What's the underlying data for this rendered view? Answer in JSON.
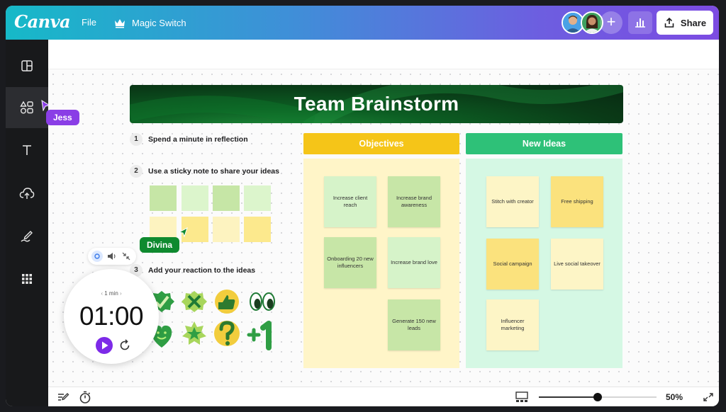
{
  "topbar": {
    "logo": "Canva",
    "file_label": "File",
    "magic_switch_label": "Magic Switch",
    "share_label": "Share",
    "gradient_colors": [
      "#16b9c8",
      "#7c4be2"
    ]
  },
  "sidebar": {
    "items": [
      {
        "icon": "layout-icon"
      },
      {
        "icon": "elements-icon",
        "active": true
      },
      {
        "icon": "text-icon"
      },
      {
        "icon": "upload-icon"
      },
      {
        "icon": "draw-icon"
      },
      {
        "icon": "apps-icon"
      }
    ]
  },
  "board": {
    "title": "Team Brainstorm",
    "steps": [
      {
        "num": "1",
        "text": "Spend a minute in reflection"
      },
      {
        "num": "2",
        "text": "Use a sticky note to share your ideas"
      },
      {
        "num": "3",
        "text": "Add your reaction to the ideas"
      }
    ],
    "columns": {
      "objectives": {
        "title": "Objectives",
        "color": "#f5c518",
        "notes": [
          "Increase client reach",
          "Increase brand awareness",
          "Onboarding 20 new influencers",
          "Increase brand love",
          "Generate 150 new leads"
        ]
      },
      "new_ideas": {
        "title": "New Ideas",
        "color": "#2ec178",
        "notes": [
          "Stitch with creator",
          "Free shipping",
          "Social campaign",
          "Live social takeover",
          "Influencer marketing"
        ]
      }
    },
    "reactions": [
      "check-badge",
      "x-badge",
      "thumbs-up-badge",
      "eyes",
      "heart-face",
      "star-badge",
      "question-mark",
      "plus-one"
    ]
  },
  "collaborators": {
    "jess": "Jess",
    "divina": "Divina"
  },
  "timer": {
    "duration": "1 min",
    "time": "01:00"
  },
  "bottombar": {
    "zoom": "50%",
    "zoom_fraction": 0.5
  }
}
